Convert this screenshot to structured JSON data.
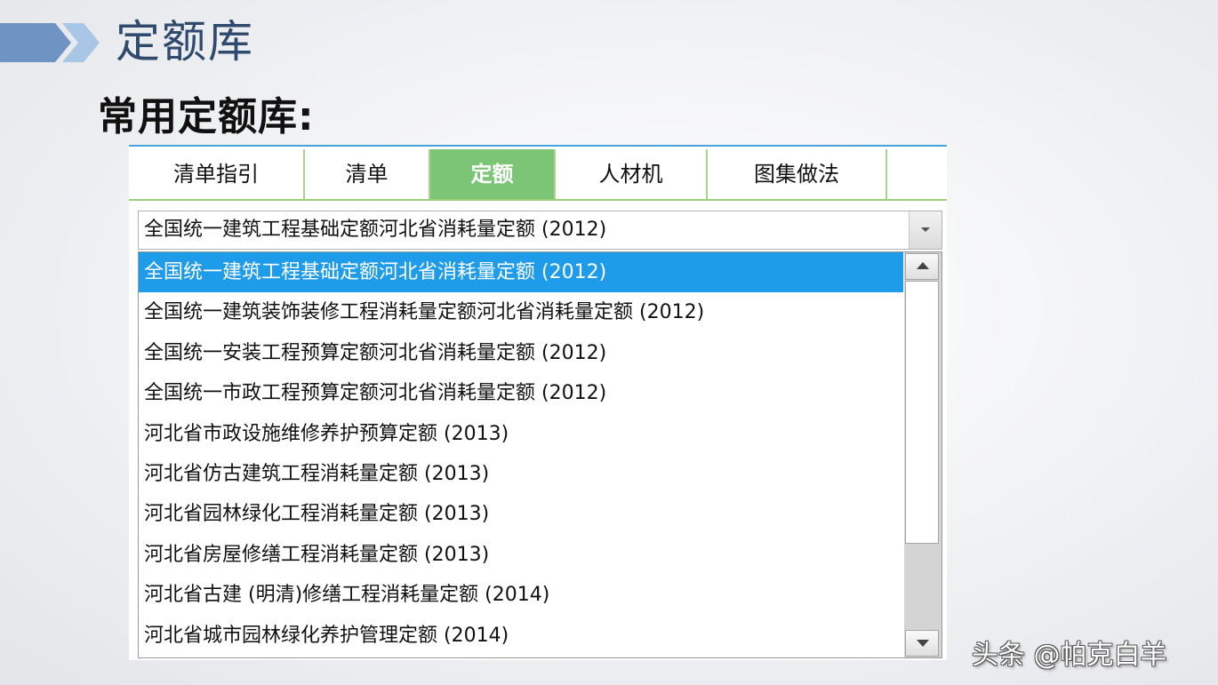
{
  "slide": {
    "title": "定额库",
    "subtitle": "常用定额库:"
  },
  "tabs": [
    {
      "label": "清单指引",
      "active": false
    },
    {
      "label": "清单",
      "active": false
    },
    {
      "label": "定额",
      "active": true
    },
    {
      "label": "人材机",
      "active": false
    },
    {
      "label": "图集做法",
      "active": false
    }
  ],
  "combo": {
    "value": "全国统一建筑工程基础定额河北省消耗量定额 (2012)"
  },
  "dropdown": {
    "items": [
      {
        "label": "全国统一建筑工程基础定额河北省消耗量定额 (2012)",
        "selected": true
      },
      {
        "label": "全国统一建筑装饰装修工程消耗量定额河北省消耗量定额 (2012)",
        "selected": false
      },
      {
        "label": "全国统一安装工程预算定额河北省消耗量定额 (2012)",
        "selected": false
      },
      {
        "label": "全国统一市政工程预算定额河北省消耗量定额 (2012)",
        "selected": false
      },
      {
        "label": "河北省市政设施维修养护预算定额 (2013)",
        "selected": false
      },
      {
        "label": "河北省仿古建筑工程消耗量定额 (2013)",
        "selected": false
      },
      {
        "label": "河北省园林绿化工程消耗量定额 (2013)",
        "selected": false
      },
      {
        "label": "河北省房屋修缮工程消耗量定额 (2013)",
        "selected": false
      },
      {
        "label": "河北省古建 (明清)修缮工程消耗量定额 (2014)",
        "selected": false
      },
      {
        "label": "河北省城市园林绿化养护管理定额 (2014)",
        "selected": false
      }
    ]
  },
  "watermark": "头条 @帕克白羊",
  "colors": {
    "title": "#2f4a6d",
    "active_tab": "#7cc576",
    "selection": "#1e9be9",
    "accent_line": "#4aa3d8"
  },
  "icons": {
    "combo_button": "chevron-down-icon",
    "scroll_up": "arrow-up-icon",
    "scroll_down": "arrow-down-icon"
  }
}
